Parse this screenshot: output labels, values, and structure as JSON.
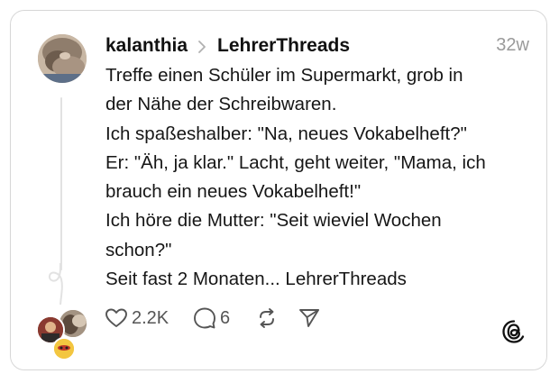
{
  "post": {
    "username": "kalanthia",
    "community": "LehrerThreads",
    "time_ago": "32w",
    "lines": [
      "Treffe einen Schüler im Supermarkt, grob in",
      "der Nähe der Schreibwaren.",
      "Ich spaßeshalber: \"Na, neues Vokabelheft?\"",
      "Er: \"Äh, ja klar.\" Lacht, geht weiter, \"Mama, ich",
      "brauch ein neues Vokabelheft!\"",
      "Ich höre die Mutter: \"Seit wieviel Wochen",
      "schon?\"",
      "Seit fast 2 Monaten... LehrerThreads"
    ]
  },
  "actions": {
    "like_icon": "heart-icon",
    "like_count": "2.2K",
    "reply_icon": "comment-icon",
    "reply_count": "6",
    "repost_icon": "repost-icon",
    "share_icon": "send-icon"
  },
  "branding": {
    "logo_icon": "threads-logo-icon"
  },
  "colors": {
    "text": "#111111",
    "muted": "#9a9a9a",
    "icon": "#555555",
    "border": "#d7d7d7",
    "thread_line": "#e2e2e2"
  }
}
